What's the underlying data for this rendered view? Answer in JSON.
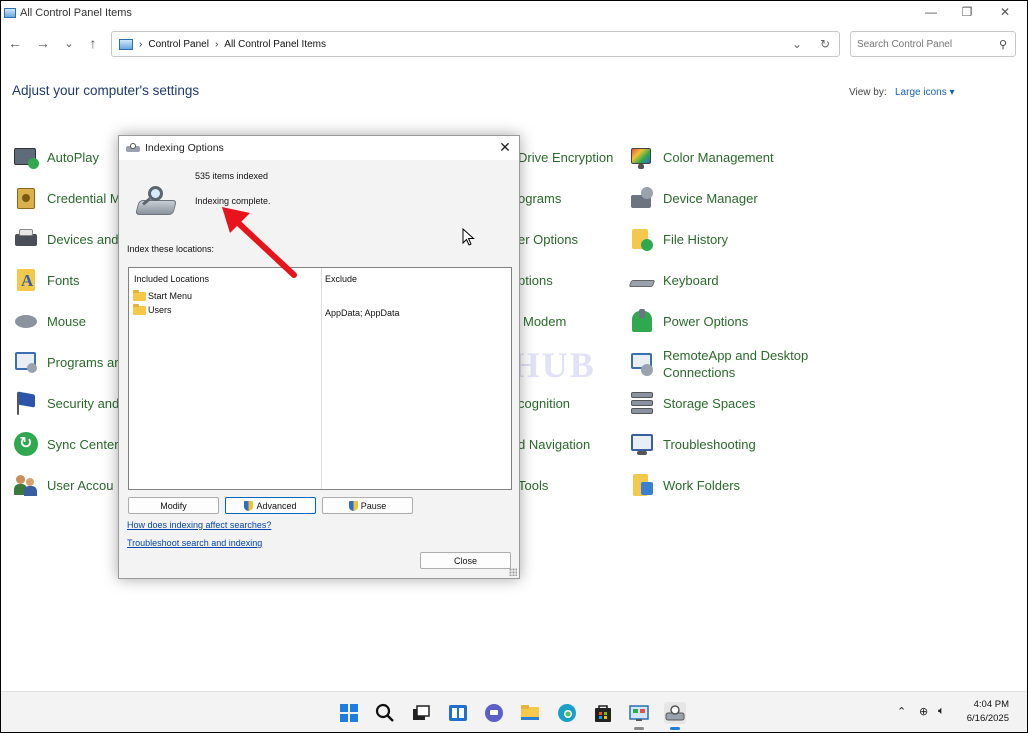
{
  "window": {
    "title": "All Control Panel Items",
    "controls": {
      "minimize": "—",
      "restore": "❐",
      "close": "✕"
    }
  },
  "nav": {
    "back": "←",
    "forward": "→",
    "recent": "⌄",
    "up": "↑",
    "breadcrumbs": [
      "Control Panel",
      "All Control Panel Items"
    ],
    "search_placeholder": "Search Control Panel"
  },
  "header": {
    "title": "Adjust your computer's settings",
    "view_by_label": "View by:",
    "view_by_value": "Large icons ▾"
  },
  "items": {
    "col1": [
      "AutoPlay",
      "Credential M",
      "Devices and",
      "Fonts",
      "Mouse",
      "Programs ar",
      "Security and",
      "Sync Center",
      "User Accou"
    ],
    "col2_partial": [
      "Drive Encryption",
      "ograms",
      "er Options",
      "ptions",
      "Modem",
      "",
      "cognition",
      "d Navigation",
      "Tools"
    ],
    "col3": [
      "Color Management",
      "Device Manager",
      "File History",
      "Keyboard",
      "Power Options",
      "RemoteApp and Desktop Connections",
      "Storage Spaces",
      "Troubleshooting",
      "Work Folders"
    ]
  },
  "watermark": "IT Pros HUB",
  "dialog": {
    "title": "Indexing Options",
    "items_indexed": "535 items indexed",
    "status": "Indexing complete.",
    "locations_label": "Index these locations:",
    "columns": {
      "included": "Included Locations",
      "exclude": "Exclude"
    },
    "locations": [
      {
        "name": "Start Menu",
        "exclude": ""
      },
      {
        "name": "Users",
        "exclude": "AppData; AppData"
      }
    ],
    "buttons": {
      "modify": "Modify",
      "advanced": "Advanced",
      "pause": "Pause",
      "close": "Close"
    },
    "links": {
      "how_affects": "How does indexing affect searches?",
      "troubleshoot": "Troubleshoot search and indexing"
    }
  },
  "taskbar": {
    "time": "4:04 PM",
    "date": "6/16/2025"
  }
}
